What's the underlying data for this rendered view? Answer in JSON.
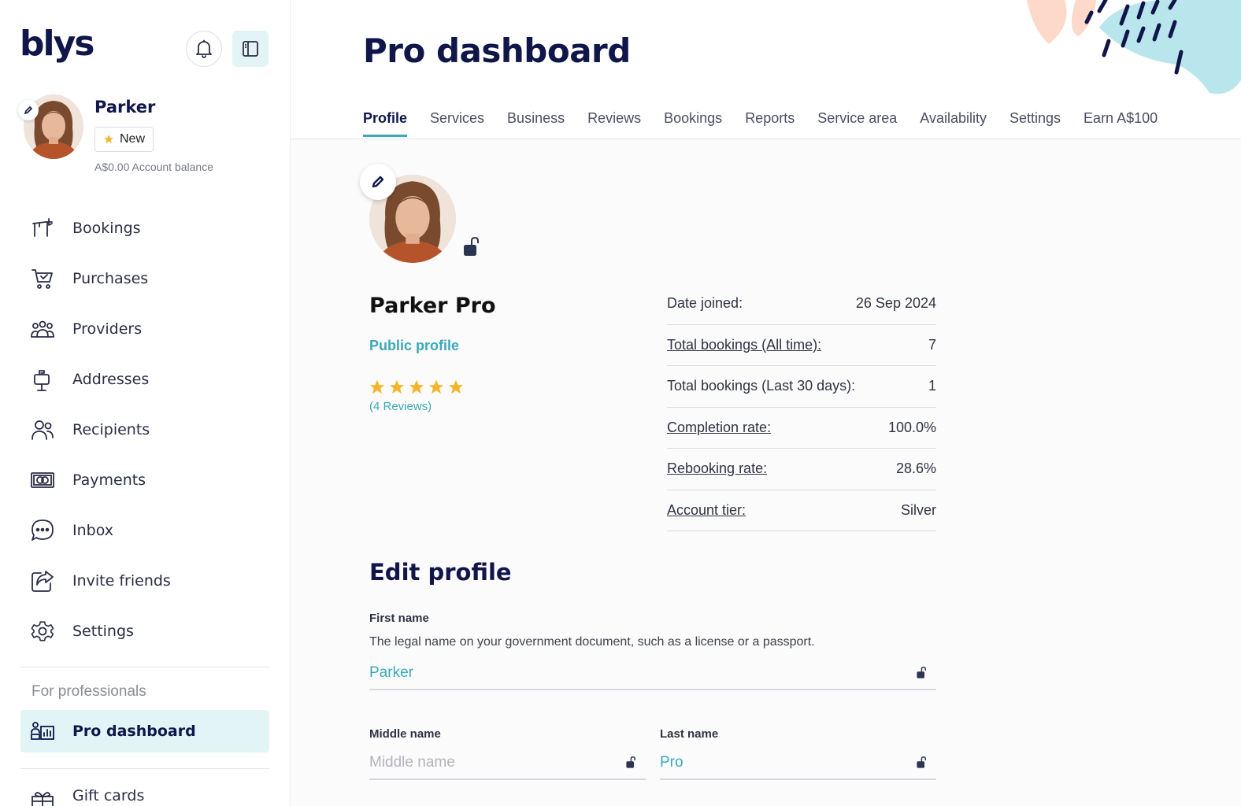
{
  "brand": {
    "logo_text": "blys",
    "accent": "#3aa9b8",
    "navy": "#10164a"
  },
  "user": {
    "name": "Parker",
    "badge": "New",
    "balance": "A$0.00 Account balance"
  },
  "nav": {
    "items": [
      {
        "label": "Bookings",
        "icon": "bookings-icon"
      },
      {
        "label": "Purchases",
        "icon": "cart-icon"
      },
      {
        "label": "Providers",
        "icon": "providers-icon"
      },
      {
        "label": "Addresses",
        "icon": "mailbox-icon"
      },
      {
        "label": "Recipients",
        "icon": "users-icon"
      },
      {
        "label": "Payments",
        "icon": "payment-icon"
      },
      {
        "label": "Inbox",
        "icon": "chat-icon"
      },
      {
        "label": "Invite friends",
        "icon": "share-icon"
      },
      {
        "label": "Settings",
        "icon": "gear-icon"
      }
    ],
    "section_label": "For professionals",
    "pro_item": "Pro dashboard",
    "gift_item": "Gift cards"
  },
  "header": {
    "title": "Pro dashboard",
    "tabs": [
      "Profile",
      "Services",
      "Business",
      "Reviews",
      "Bookings",
      "Reports",
      "Service area",
      "Availability",
      "Settings",
      "Earn A$100"
    ],
    "active_tab": "Profile"
  },
  "profile": {
    "name": "Parker Pro",
    "public_link": "Public profile",
    "rating": 5,
    "reviews": "(4 Reviews)"
  },
  "stats": [
    {
      "label": "Date joined:",
      "value": "26 Sep 2024",
      "underline": false
    },
    {
      "label": "Total bookings (All time):",
      "value": "7",
      "underline": true
    },
    {
      "label": "Total bookings (Last 30 days):",
      "value": "1",
      "underline": false
    },
    {
      "label": "Completion rate:",
      "value": "100.0%",
      "underline": true
    },
    {
      "label": "Rebooking rate:",
      "value": "28.6%",
      "underline": true
    },
    {
      "label": "Account tier:",
      "value": "Silver",
      "underline": true
    }
  ],
  "edit": {
    "title": "Edit profile",
    "first_name_label": "First name",
    "first_name_help": "The legal name on your government document, such as a license or a passport.",
    "first_name_value": "Parker",
    "middle_name_label": "Middle name",
    "middle_name_placeholder": "Middle name",
    "middle_name_value": "",
    "last_name_label": "Last name",
    "last_name_value": "Pro"
  }
}
